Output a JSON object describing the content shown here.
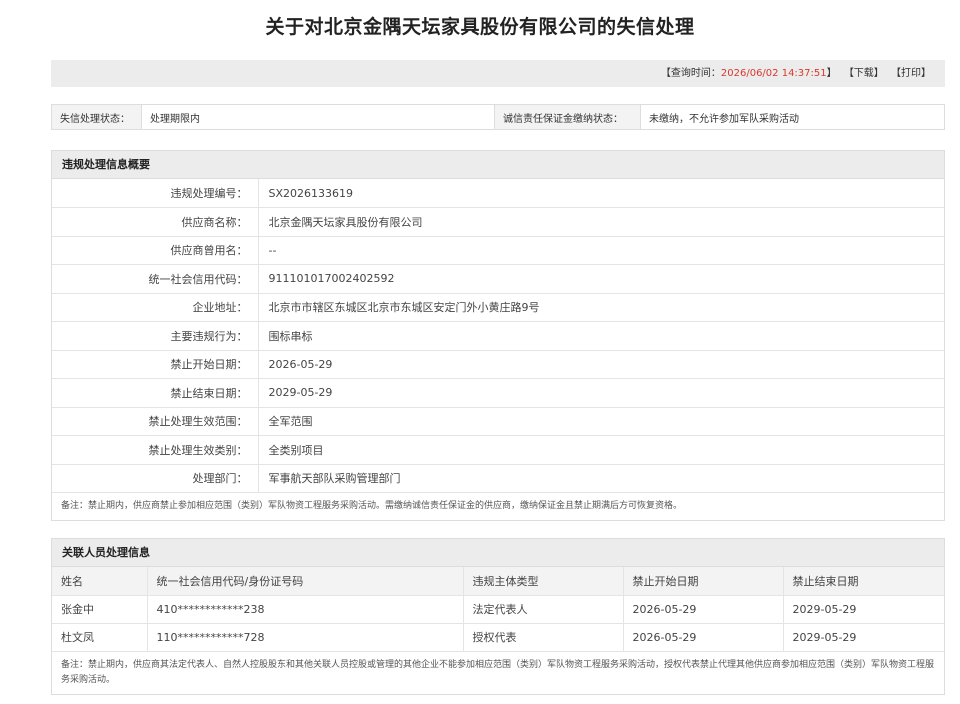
{
  "title": "关于对北京金隅天坛家具股份有限公司的失信处理",
  "query": {
    "label": "【查询时间：",
    "time": "2026/06/02 14:37:51",
    "close": "】",
    "download": "【下载】",
    "print": "【打印】"
  },
  "status": {
    "status_label": "失信处理状态：",
    "status_value": "处理期限内",
    "deposit_label": "诚信责任保证金缴纳状态：",
    "deposit_value": "未缴纳，不允许参加军队采购活动"
  },
  "violation": {
    "header": "违规处理信息概要",
    "rows": [
      {
        "k": "违规处理编号：",
        "v": "SX2026133619"
      },
      {
        "k": "供应商名称：",
        "v": "北京金隅天坛家具股份有限公司"
      },
      {
        "k": "供应商曾用名：",
        "v": "--"
      },
      {
        "k": "统一社会信用代码：",
        "v": "911101017002402592"
      },
      {
        "k": "企业地址：",
        "v": "北京市市辖区东城区北京市东城区安定门外小黄庄路9号"
      },
      {
        "k": "主要违规行为：",
        "v": "围标串标"
      },
      {
        "k": "禁止开始日期：",
        "v": "2026-05-29"
      },
      {
        "k": "禁止结束日期：",
        "v": "2029-05-29"
      },
      {
        "k": "禁止处理生效范围：",
        "v": "全军范围"
      },
      {
        "k": "禁止处理生效类别：",
        "v": "全类别项目"
      },
      {
        "k": "处理部门：",
        "v": "军事航天部队采购管理部门"
      }
    ],
    "note": "备注：禁止期内，供应商禁止参加相应范围（类别）军队物资工程服务采购活动。需缴纳诚信责任保证金的供应商，缴纳保证金且禁止期满后方可恢复资格。"
  },
  "related": {
    "header": "关联人员处理信息",
    "columns": [
      "姓名",
      "统一社会信用代码/身份证号码",
      "违规主体类型",
      "禁止开始日期",
      "禁止结束日期"
    ],
    "rows": [
      [
        "张金中",
        "410************238",
        "法定代表人",
        "2026-05-29",
        "2029-05-29"
      ],
      [
        "杜文凤",
        "110************728",
        "授权代表",
        "2026-05-29",
        "2029-05-29"
      ]
    ],
    "note": "备注：禁止期内，供应商其法定代表人、自然人控股股东和其他关联人员控股或管理的其他企业不能参加相应范围（类别）军队物资工程服务采购活动，授权代表禁止代理其他供应商参加相应范围（类别）军队物资工程服务采购活动。"
  }
}
